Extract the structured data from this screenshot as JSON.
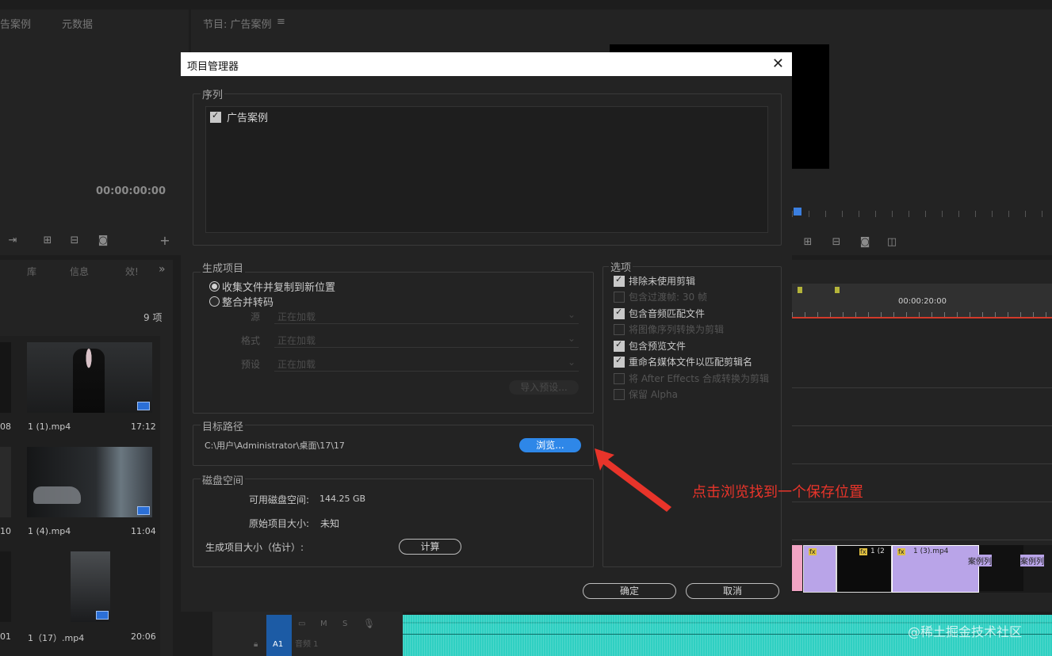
{
  "top_left_panel": {
    "tabs": [
      "告案例",
      "元数据"
    ],
    "timecode": "00:00:00:00"
  },
  "program_monitor": {
    "tab_label": "节目: 广告案例",
    "menu_icon": "≡"
  },
  "project_panel": {
    "tabs": [
      "库",
      "信息",
      "效!"
    ],
    "overflow": "»",
    "item_count": "9 项",
    "clips": [
      {
        "left_time": "08",
        "name": "1 (1).mp4",
        "duration": "17:12"
      },
      {
        "left_time": "10",
        "name": "1 (4).mp4",
        "duration": "11:04"
      },
      {
        "left_time": "01",
        "name": "1（17）.mp4",
        "duration": "20:06"
      }
    ]
  },
  "timeline": {
    "timecode": "00:00:20:00",
    "clips": [
      "1 (2",
      "1 (3).mp4",
      "案例列",
      "案例列"
    ],
    "track_label": "A1",
    "track_name": "音频 1",
    "track_buttons": [
      "M",
      "S"
    ]
  },
  "dialog": {
    "title": "项目管理器",
    "close_glyph": "✕",
    "sequence_group": {
      "label": "序列",
      "items": [
        {
          "label": "广告案例",
          "checked": true
        }
      ]
    },
    "result_group": {
      "label": "生成项目",
      "radios": [
        {
          "label": "收集文件并复制到新位置",
          "selected": true
        },
        {
          "label": "整合并转码",
          "selected": false
        }
      ],
      "fields": [
        {
          "label": "源",
          "value": "正在加载"
        },
        {
          "label": "格式",
          "value": "正在加载"
        },
        {
          "label": "预设",
          "value": "正在加载"
        }
      ],
      "import_preset_label": "导入预设..."
    },
    "options_group": {
      "label": "选项",
      "items": [
        {
          "label": "排除未使用剪辑",
          "checked": true,
          "enabled": true
        },
        {
          "label": "包含过渡帧: 30 帧",
          "checked": false,
          "enabled": false
        },
        {
          "label": "包含音频匹配文件",
          "checked": true,
          "enabled": true
        },
        {
          "label": "将图像序列转换为剪辑",
          "checked": false,
          "enabled": false
        },
        {
          "label": "包含预览文件",
          "checked": true,
          "enabled": true
        },
        {
          "label": "重命名媒体文件以匹配剪辑名",
          "checked": true,
          "enabled": true
        },
        {
          "label": "将 After Effects 合成转换为剪辑",
          "checked": false,
          "enabled": false
        },
        {
          "label": "保留 Alpha",
          "checked": false,
          "enabled": false
        }
      ]
    },
    "destination_group": {
      "label": "目标路径",
      "path": "C:\\用户\\Administrator\\桌面\\17\\17",
      "browse_label": "浏览..."
    },
    "disk_group": {
      "label": "磁盘空间",
      "available_label": "可用磁盘空间:",
      "available_value": "144.25 GB",
      "original_label": "原始项目大小:",
      "original_value": "未知",
      "estimated_label": "生成项目大小（估计）:",
      "calculate_label": "计算"
    },
    "ok_label": "确定",
    "cancel_label": "取消"
  },
  "annotation": {
    "text": "点击浏览找到一个保存位置",
    "color": "#e8342a"
  },
  "watermark": "@稀土掘金技术社区",
  "colors": {
    "accent_blue": "#2e87e8",
    "playhead_red": "#d23a2a",
    "timeline_purple": "#b9a4e8",
    "audio_teal": "#2fd0c2"
  }
}
